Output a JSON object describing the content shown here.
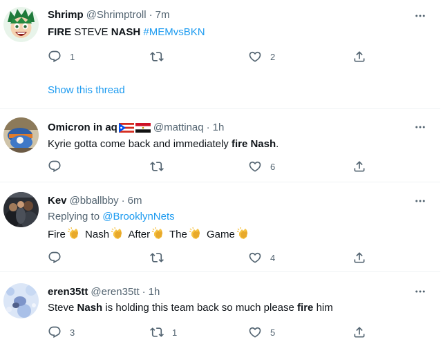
{
  "tweets": [
    {
      "name": "Shrimp",
      "handle": "@Shrimptroll",
      "dot": "·",
      "time": "7m",
      "text": {
        "w1": "FIRE",
        "w2": "STEVE",
        "w3": "NASH",
        "hashtag": "#MEMvsBKN"
      },
      "reply_count": "1",
      "retweet_count": "",
      "like_count": "2",
      "show_thread": "Show this thread"
    },
    {
      "name": "Omicron in aq",
      "handle": "@mattinaq",
      "dot": "·",
      "time": "1h",
      "text": {
        "a": "Kyrie gotta come back and immediately",
        "b": "fire Nash",
        "c": "."
      },
      "reply_count": "",
      "retweet_count": "",
      "like_count": "6"
    },
    {
      "name": "Kev",
      "handle": "@bballbby",
      "dot": "·",
      "time": "6m",
      "replying_prefix": "Replying to",
      "replying_to": "@BrooklynNets",
      "words": [
        "Fire",
        "Nash",
        "After",
        "The",
        "Game"
      ],
      "reply_count": "",
      "retweet_count": "",
      "like_count": "4"
    },
    {
      "name": "eren35tt",
      "handle": "@eren35tt",
      "dot": "·",
      "time": "1h",
      "text": {
        "a": "Steve",
        "b": "Nash",
        "c": "is holding this team back so much please",
        "d": "fire",
        "e": "him"
      },
      "reply_count": "3",
      "retweet_count": "1",
      "like_count": "5"
    }
  ],
  "colors": {
    "link": "#1d9bf0",
    "muted": "#536471",
    "text": "#0f1419",
    "divider": "#eff3f4"
  },
  "icons": [
    "reply-icon",
    "retweet-icon",
    "like-icon",
    "share-icon",
    "more-icon",
    "clap-emoji",
    "flag-emoji"
  ]
}
